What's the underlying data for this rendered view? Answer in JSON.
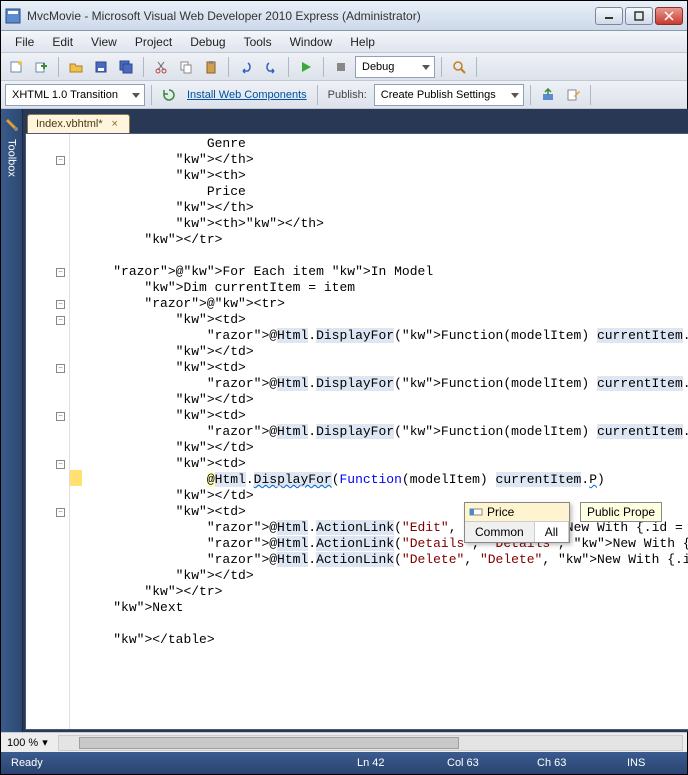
{
  "window": {
    "title": "MvcMovie - Microsoft Visual Web Developer 2010 Express (Administrator)"
  },
  "menu": [
    "File",
    "Edit",
    "View",
    "Project",
    "Debug",
    "Tools",
    "Window",
    "Help"
  ],
  "toolbar1": {
    "config_dropdown": "Debug"
  },
  "toolbar2": {
    "doctype_dropdown": "XHTML 1.0 Transition",
    "install_link": "Install Web Components",
    "publish_label": "Publish:",
    "publish_dropdown": "Create Publish Settings"
  },
  "sidepanel": {
    "label": "Toolbox"
  },
  "tab": {
    "name": "Index.vbhtml*"
  },
  "code": {
    "lines": [
      "                Genre",
      "            </th>",
      "            <th>",
      "                Price",
      "            </th>",
      "            <th></th>",
      "        </tr>",
      "",
      "    @For Each item In Model",
      "        Dim currentItem = item",
      "        @<tr>",
      "            <td>",
      "                @Html.DisplayFor(Function(modelItem) currentItem.Title)",
      "            </td>",
      "            <td>",
      "                @Html.DisplayFor(Function(modelItem) currentItem.ReleaseDate)",
      "            </td>",
      "            <td>",
      "                @Html.DisplayFor(Function(modelItem) currentItem.Genre)",
      "            </td>",
      "            <td>",
      "                @Html.DisplayFor(Function(modelItem) currentItem.P)",
      "            </td>",
      "            <td>",
      "                @Html.ActionLink(\"Edit\", \"Edit\", New With {.id =",
      "                @Html.ActionLink(\"Details\", \"Details\", New With {.id = currentItem.ID})",
      "                @Html.ActionLink(\"Delete\", \"Delete\", New With {.id = currentItem.ID})",
      "            </td>",
      "        </tr>",
      "    Next",
      "",
      "    </table>",
      ""
    ]
  },
  "intellisense": {
    "item": "Price",
    "tabs": [
      "Common",
      "All"
    ],
    "info": "Public Prope"
  },
  "zoom": {
    "value": "100 %"
  },
  "status": {
    "ready": "Ready",
    "ln": "Ln 42",
    "col": "Col 63",
    "ch": "Ch 63",
    "ins": "INS"
  }
}
